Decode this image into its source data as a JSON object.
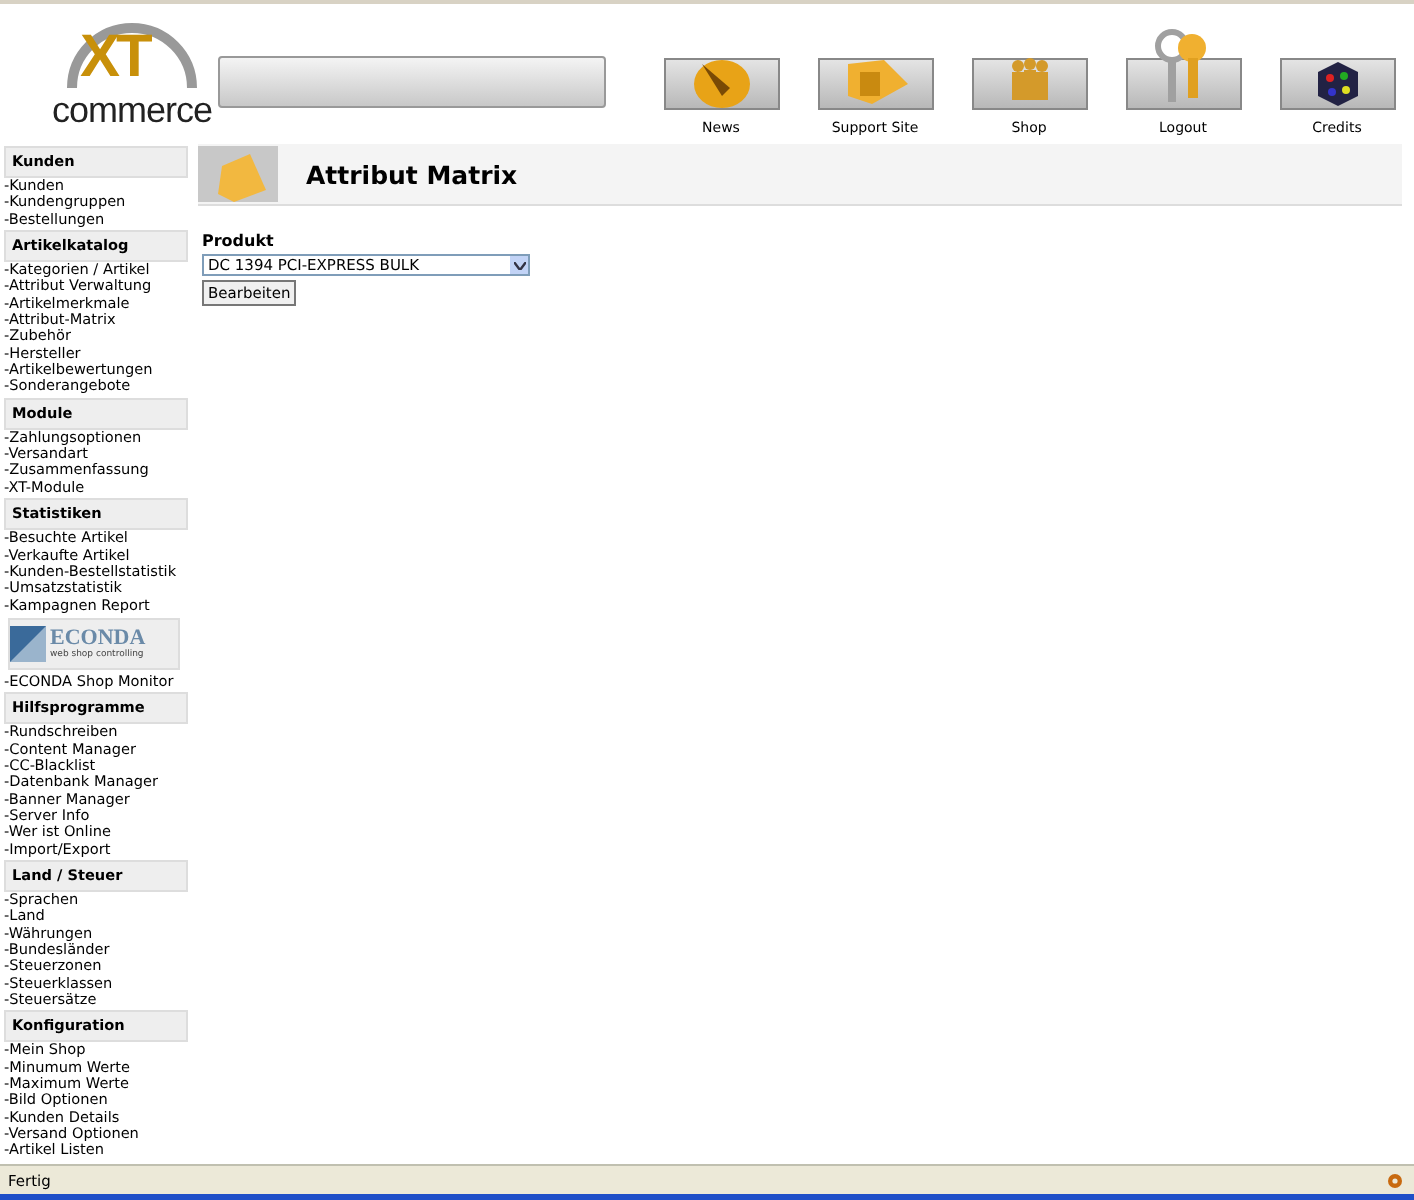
{
  "logo": {
    "letters": "XT",
    "word": "commerce"
  },
  "nav": [
    {
      "label": "News"
    },
    {
      "label": "Support Site"
    },
    {
      "label": "Shop"
    },
    {
      "label": "Logout"
    },
    {
      "label": "Credits"
    }
  ],
  "sidebar": {
    "sections": [
      {
        "kind": "menu",
        "title": "Kunden",
        "items": [
          "-Kunden",
          "-Kundengruppen",
          "-Bestellungen"
        ]
      },
      {
        "kind": "menu",
        "title": "Artikelkatalog",
        "items": [
          "-Kategorien / Artikel",
          "-Attribut Verwaltung",
          "-Artikelmerkmale",
          "-Attribut-Matrix",
          "-Zubehör",
          "-Hersteller",
          "-Artikelbewertungen",
          "-Sonderangebote"
        ]
      },
      {
        "kind": "menu",
        "title": "Module",
        "items": [
          "-Zahlungsoptionen",
          "-Versandart",
          "-Zusammenfassung",
          "-XT-Module"
        ]
      },
      {
        "kind": "menu",
        "title": "Statistiken",
        "items": [
          "-Besuchte Artikel",
          "-Verkaufte Artikel",
          "-Kunden-Bestellstatistik",
          "-Umsatzstatistik",
          "-Kampagnen Report"
        ]
      },
      {
        "kind": "banner",
        "logo": "ECONDA",
        "tagline": "web shop controlling",
        "items": [
          "-ECONDA Shop Monitor"
        ]
      },
      {
        "kind": "menu",
        "title": "Hilfsprogramme",
        "items": [
          "-Rundschreiben",
          "-Content Manager",
          "-CC-Blacklist",
          "-Datenbank Manager",
          "-Banner Manager",
          "-Server Info",
          "-Wer ist Online",
          "-Import/Export"
        ]
      },
      {
        "kind": "menu",
        "title": "Land / Steuer",
        "items": [
          "-Sprachen",
          "-Land",
          "-Währungen",
          "-Bundesländer",
          "-Steuerzonen",
          "-Steuerklassen",
          "-Steuersätze"
        ]
      },
      {
        "kind": "menu",
        "title": "Konfiguration",
        "items": [
          "-Mein Shop",
          "-Minumum Werte",
          "-Maximum Werte",
          "-Bild Optionen",
          "-Kunden Details",
          "-Versand Optionen",
          "-Artikel Listen"
        ]
      }
    ]
  },
  "main": {
    "title": "Attribut Matrix",
    "field_label": "Produkt",
    "select": {
      "value": "DC 1394 PCI-EXPRESS BULK"
    },
    "button": "Bearbeiten"
  },
  "status_bar": {
    "text": "Fertig"
  }
}
